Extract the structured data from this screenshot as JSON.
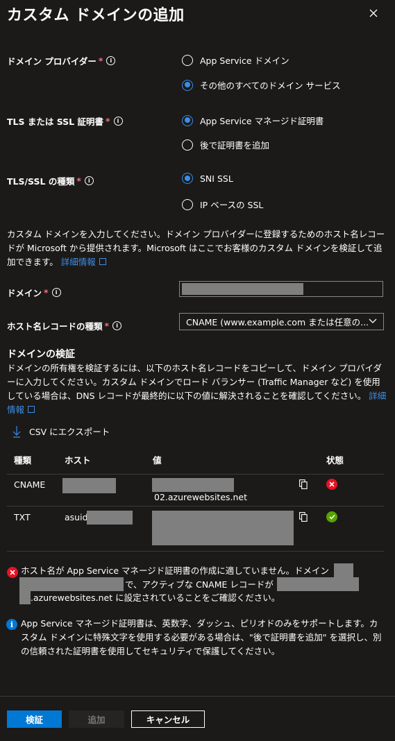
{
  "header": {
    "title": "カスタム ドメインの追加",
    "close_icon": "close-icon"
  },
  "provider": {
    "label": "ドメイン プロバイダー",
    "required": "*",
    "options": [
      {
        "label": "App Service ドメイン",
        "selected": false
      },
      {
        "label": "その他のすべてのドメイン サービス",
        "selected": true
      }
    ]
  },
  "tls": {
    "label": "TLS または SSL 証明書",
    "required": "*",
    "options": [
      {
        "label": "App Service マネージド証明書",
        "selected": true
      },
      {
        "label": "後で証明書を追加",
        "selected": false
      }
    ]
  },
  "ssl_type": {
    "label": "TLS/SSL の種類",
    "required": "*",
    "options": [
      {
        "label": "SNI SSL",
        "selected": true
      },
      {
        "label": "IP ベースの SSL",
        "selected": false
      }
    ]
  },
  "intro": {
    "text": "カスタム ドメインを入力してください。ドメイン プロバイダーに登録するためのホスト名レコードが Microsoft から提供されます。Microsoft はここでお客様のカスタム ドメインを検証して追加できます。",
    "link": "詳細情報"
  },
  "domain": {
    "label": "ドメイン",
    "required": "*",
    "value": ""
  },
  "record_type": {
    "label": "ホスト名レコードの種類",
    "required": "*",
    "value": "CNAME (www.example.com または任意の..."
  },
  "validation": {
    "heading": "ドメインの検証",
    "text": "ドメインの所有権を検証するには、以下のホスト名レコードをコピーして、ドメイン プロバイダーに入力してください。カスタム ドメインでロード バランサー (Traffic Manager など) を使用している場合は、DNS レコードが最終的に以下の値に解決されることを確認してください。",
    "link": "詳細情報",
    "export": "CSV にエクスポート"
  },
  "table": {
    "headers": [
      "種類",
      "ホスト",
      "値",
      "状態"
    ],
    "rows": [
      {
        "type": "CNAME",
        "host": "",
        "value": "02.azurewebsites.net",
        "status": "error"
      },
      {
        "type": "TXT",
        "host": "asuid",
        "value": "",
        "status": "success"
      }
    ]
  },
  "messages": {
    "error_part1": "ホスト名が App Service マネージド証明書の作成に適していません。ドメイン",
    "error_part2": "で、アクティブな CNAME レコードが",
    "error_part3": ".azurewebsites.net に設定されていることをご確認ください。",
    "info": "App Service マネージド証明書は、英数字、ダッシュ、ピリオドのみをサポートします。カスタム ドメインに特殊文字を使用する必要がある場合は、\"後で証明書を追加\" を選択し、別の信頼された証明書を使用してセキュリティで保護してください。"
  },
  "footer": {
    "validate": "検証",
    "add": "追加",
    "cancel": "キャンセル"
  },
  "colors": {
    "accent": "#0078d4",
    "link": "#3c8de7",
    "error": "#e81123",
    "success": "#57a300"
  }
}
